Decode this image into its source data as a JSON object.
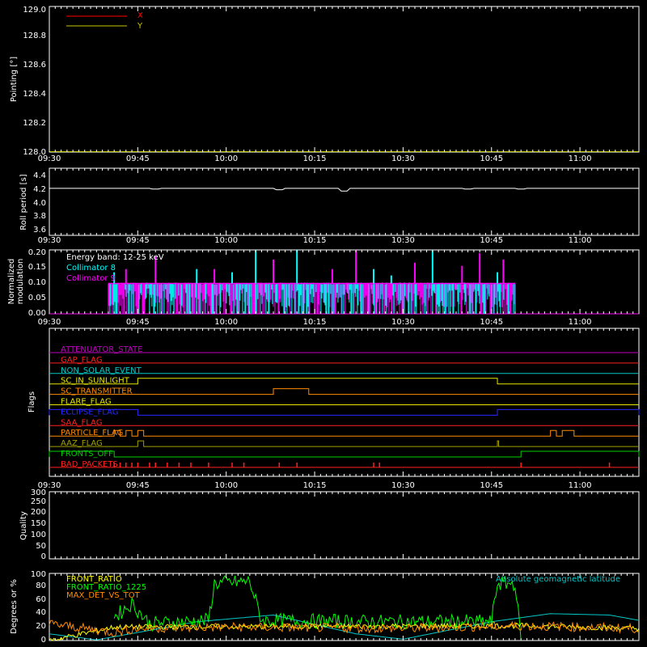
{
  "time_ticks": [
    "09:30",
    "09:45",
    "10:00",
    "10:15",
    "10:30",
    "10:45",
    "11:00"
  ],
  "panels": {
    "pointing": {
      "ylabel": "Pointing [°]",
      "yticks": [
        "128.0",
        "128.2",
        "128.4",
        "128.6",
        "128.8",
        "129.0"
      ],
      "legend": [
        {
          "label": "X",
          "color": "#ff0000"
        },
        {
          "label": "Y",
          "color": "#c8c800"
        }
      ]
    },
    "roll": {
      "ylabel": "Roll period [s]",
      "yticks": [
        "3.6",
        "3.8",
        "4.0",
        "4.2",
        "4.4"
      ]
    },
    "modulation": {
      "ylabel_line1": "Normalized",
      "ylabel_line2": "modulation",
      "yticks": [
        "0.00",
        "0.05",
        "0.10",
        "0.15",
        "0.20"
      ],
      "energy_band": "Energy band: 12-25 keV",
      "legend": [
        {
          "label": "Collimator 8",
          "color": "#00ffff"
        },
        {
          "label": "Collimator 9",
          "color": "#ff00ff"
        }
      ]
    },
    "flags": {
      "ylabel": "Flags",
      "rows": [
        {
          "label": "ATTENUATOR_STATE",
          "color": "#c000c0"
        },
        {
          "label": "GAP_FLAG",
          "color": "#ff2020"
        },
        {
          "label": "NON_SOLAR_EVENT",
          "color": "#00c8c8"
        },
        {
          "label": "SC_IN_SUNLIGHT",
          "color": "#e6e600"
        },
        {
          "label": "SC_TRANSMITTER",
          "color": "#ff8c00"
        },
        {
          "label": "FLARE_FLAG",
          "color": "#e6e600"
        },
        {
          "label": "ECLIPSE_FLAG",
          "color": "#2828ff"
        },
        {
          "label": "SAA_FLAG",
          "color": "#ff2020"
        },
        {
          "label": "PARTICLE_FLAG",
          "color": "#ff8c00"
        },
        {
          "label": "AAZ_FLAG",
          "color": "#a0a000"
        },
        {
          "label": "FRONTS_OFF",
          "color": "#00d000"
        },
        {
          "label": "BAD_PACKETS",
          "color": "#ff2020"
        }
      ]
    },
    "quality": {
      "ylabel": "Quality",
      "yticks": [
        "0",
        "50",
        "100",
        "150",
        "200",
        "250",
        "300"
      ]
    },
    "ratio": {
      "ylabel": "Degrees or %",
      "yticks": [
        "0",
        "20",
        "40",
        "60",
        "80",
        "100"
      ],
      "legend": [
        {
          "label": "FRONT_RATIO",
          "color": "#ffff00"
        },
        {
          "label": "FRONT_RATIO_1225",
          "color": "#00ff00"
        },
        {
          "label": "MAX_DET_VS_TOT",
          "color": "#ff8c00"
        }
      ],
      "right_label": "Absolute geomagnetic latitude",
      "right_color": "#00c8c8"
    }
  },
  "chart_data": [
    {
      "type": "line",
      "name": "pointing",
      "ylim": [
        128.0,
        129.0
      ],
      "xlim": [
        "09:30",
        "11:10"
      ],
      "series": [
        {
          "name": "X",
          "x": [
            "09:30",
            "11:10"
          ],
          "values": [
            128.0,
            128.0
          ]
        },
        {
          "name": "Y",
          "x": [
            "09:30",
            "11:10"
          ],
          "values": [
            128.0,
            128.0
          ]
        }
      ]
    },
    {
      "type": "line",
      "name": "roll_period",
      "ylim": [
        3.5,
        4.5
      ],
      "xlim": [
        "09:30",
        "11:10"
      ],
      "base_value": 4.2,
      "dips": [
        {
          "t": "09:48",
          "v": 4.19
        },
        {
          "t": "10:09",
          "v": 4.18
        },
        {
          "t": "10:20",
          "v": 4.16
        },
        {
          "t": "10:41",
          "v": 4.19
        },
        {
          "t": "10:50",
          "v": 4.19
        }
      ]
    },
    {
      "type": "line",
      "name": "normalized_modulation",
      "ylim": [
        0.0,
        0.2
      ],
      "xlim": [
        "09:30",
        "11:10"
      ],
      "active_range": [
        "09:40",
        "10:49"
      ],
      "typical_level": 0.095,
      "series": [
        {
          "name": "Collimator 8",
          "spikes": [
            {
              "t": "09:41",
              "v": 0.13
            },
            {
              "t": "09:55",
              "v": 0.14
            },
            {
              "t": "10:01",
              "v": 0.13
            },
            {
              "t": "10:05",
              "v": 0.2
            },
            {
              "t": "10:12",
              "v": 0.2
            },
            {
              "t": "10:25",
              "v": 0.14
            },
            {
              "t": "10:28",
              "v": 0.12
            },
            {
              "t": "10:35",
              "v": 0.2
            },
            {
              "t": "10:46",
              "v": 0.13
            }
          ]
        },
        {
          "name": "Collimator 9",
          "spikes": [
            {
              "t": "09:43",
              "v": 0.14
            },
            {
              "t": "09:48",
              "v": 0.18
            },
            {
              "t": "09:58",
              "v": 0.14
            },
            {
              "t": "10:08",
              "v": 0.17
            },
            {
              "t": "10:18",
              "v": 0.14
            },
            {
              "t": "10:22",
              "v": 0.2
            },
            {
              "t": "10:32",
              "v": 0.16
            },
            {
              "t": "10:40",
              "v": 0.15
            },
            {
              "t": "10:43",
              "v": 0.19
            },
            {
              "t": "10:47",
              "v": 0.17
            }
          ]
        }
      ]
    },
    {
      "type": "table",
      "name": "flags",
      "xlim": [
        "09:30",
        "11:10"
      ],
      "flag_intervals": {
        "ATTENUATOR_STATE": [],
        "GAP_FLAG": [],
        "NON_SOLAR_EVENT": [],
        "SC_IN_SUNLIGHT": [
          [
            "09:45",
            "10:46"
          ]
        ],
        "SC_TRANSMITTER": [
          [
            "10:08",
            "10:14"
          ]
        ],
        "FLARE_FLAG": [],
        "ECLIPSE_FLAG": [
          [
            "09:30",
            "09:45"
          ],
          [
            "10:46",
            "11:10"
          ]
        ],
        "SAA_FLAG": [],
        "PARTICLE_FLAG": [
          [
            "09:41",
            "09:42"
          ],
          [
            "09:43",
            "09:44"
          ],
          [
            "09:45",
            "09:46"
          ],
          [
            "10:55",
            "10:56"
          ],
          [
            "10:57",
            "10:59"
          ]
        ],
        "AAZ_FLAG": [
          [
            "09:45",
            "09:46"
          ],
          [
            "10:46",
            "10:46"
          ]
        ],
        "FRONTS_OFF": [
          [
            "09:30",
            "09:41"
          ],
          [
            "10:50",
            "11:10"
          ]
        ],
        "BAD_PACKETS": [
          "09:41",
          "09:42",
          "09:43",
          "09:44",
          "09:45",
          "09:47",
          "09:48",
          "09:50",
          "09:52",
          "09:54",
          "09:57",
          "10:01",
          "10:03",
          "10:09",
          "10:12",
          "10:25",
          "10:26",
          "10:50",
          "11:05"
        ]
      }
    },
    {
      "type": "line",
      "name": "quality",
      "ylim": [
        0,
        300
      ],
      "xlim": [
        "09:30",
        "11:10"
      ],
      "series": []
    },
    {
      "type": "line",
      "name": "ratios",
      "ylim": [
        0,
        100
      ],
      "xlim": [
        "09:30",
        "11:10"
      ],
      "series": [
        {
          "name": "FRONT_RATIO",
          "x": [
            "09:30",
            "09:41",
            "10:50",
            "11:10"
          ],
          "values": [
            0,
            20,
            22,
            18
          ]
        },
        {
          "name": "FRONT_RATIO_1225",
          "x": [
            "09:41",
            "09:44",
            "09:47",
            "09:53",
            "09:57",
            "09:58",
            "10:04",
            "10:06",
            "10:24",
            "10:45",
            "10:46",
            "10:49",
            "10:50"
          ],
          "values": [
            35,
            55,
            25,
            28,
            30,
            85,
            88,
            30,
            28,
            28,
            85,
            85,
            0
          ]
        },
        {
          "name": "MAX_DET_VS_TOT",
          "x": [
            "09:30",
            "09:41",
            "09:45",
            "10:00",
            "10:30",
            "10:50",
            "11:10"
          ],
          "values": [
            25,
            12,
            18,
            20,
            18,
            22,
            18
          ]
        },
        {
          "name": "Absolute geomagnetic latitude",
          "x": [
            "09:30",
            "09:38",
            "09:45",
            "09:55",
            "10:08",
            "10:22",
            "10:30",
            "10:45",
            "10:55",
            "11:05",
            "11:10"
          ],
          "values": [
            10,
            1,
            12,
            28,
            38,
            10,
            2,
            28,
            40,
            38,
            30
          ]
        }
      ]
    }
  ]
}
